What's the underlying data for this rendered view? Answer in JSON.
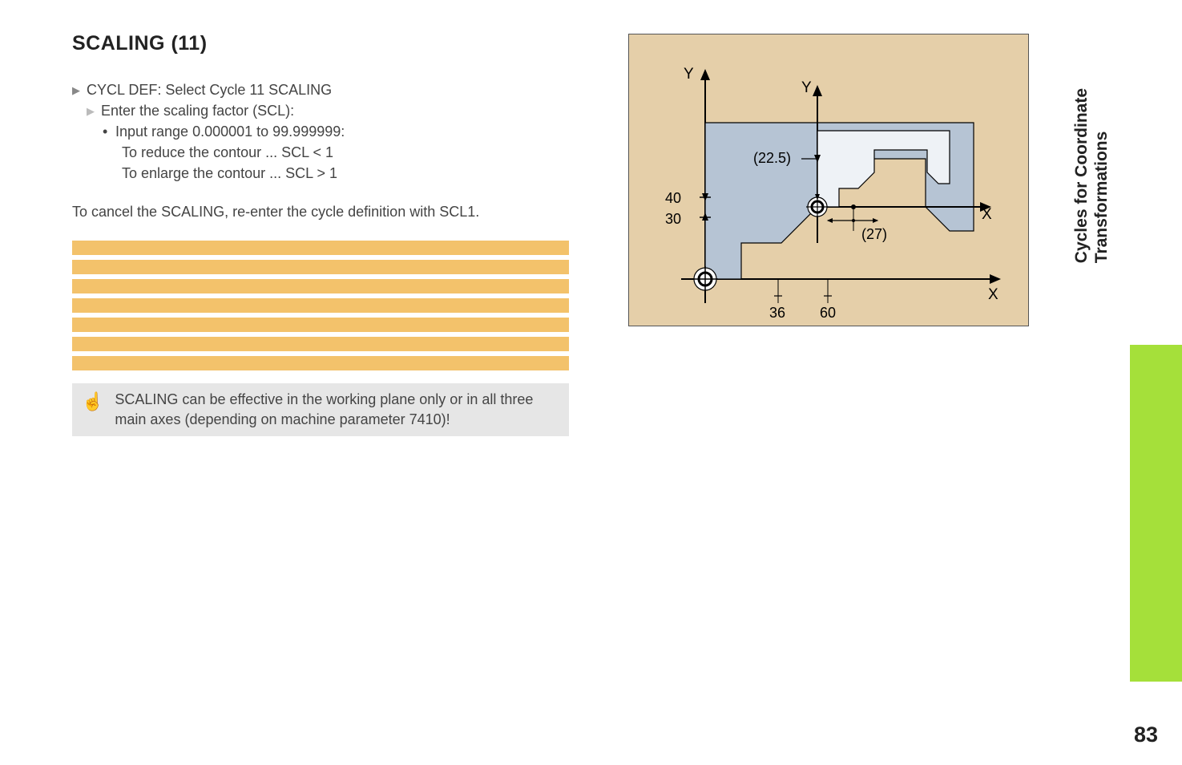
{
  "heading": "SCALING (11)",
  "bullets": {
    "l1": "CYCL DEF: Select Cycle 11 SCALING",
    "l2": "Enter the scaling factor (SCL):",
    "l3": "Input range 0.000001 to 99.999999:",
    "l4a": "To reduce the contour ... SCL < 1",
    "l4b": "To enlarge the contour ... SCL > 1"
  },
  "cancel": "To cancel the SCALING, re-enter the cycle definition with SCL1.",
  "note": "SCALING can be effective in the working plane only or in all three main axes (depending on machine parameter 7410)!",
  "sidebar": {
    "line1": "Cycles for Coordinate",
    "line2": "Transformations"
  },
  "pagenum": "83",
  "diagram": {
    "axis_y1": "Y",
    "axis_y2": "Y",
    "axis_x1": "X",
    "axis_x2": "X",
    "y40": "40",
    "y30": "30",
    "y225": "(22.5)",
    "x36": "36",
    "x60": "60",
    "x27": "(27)"
  }
}
